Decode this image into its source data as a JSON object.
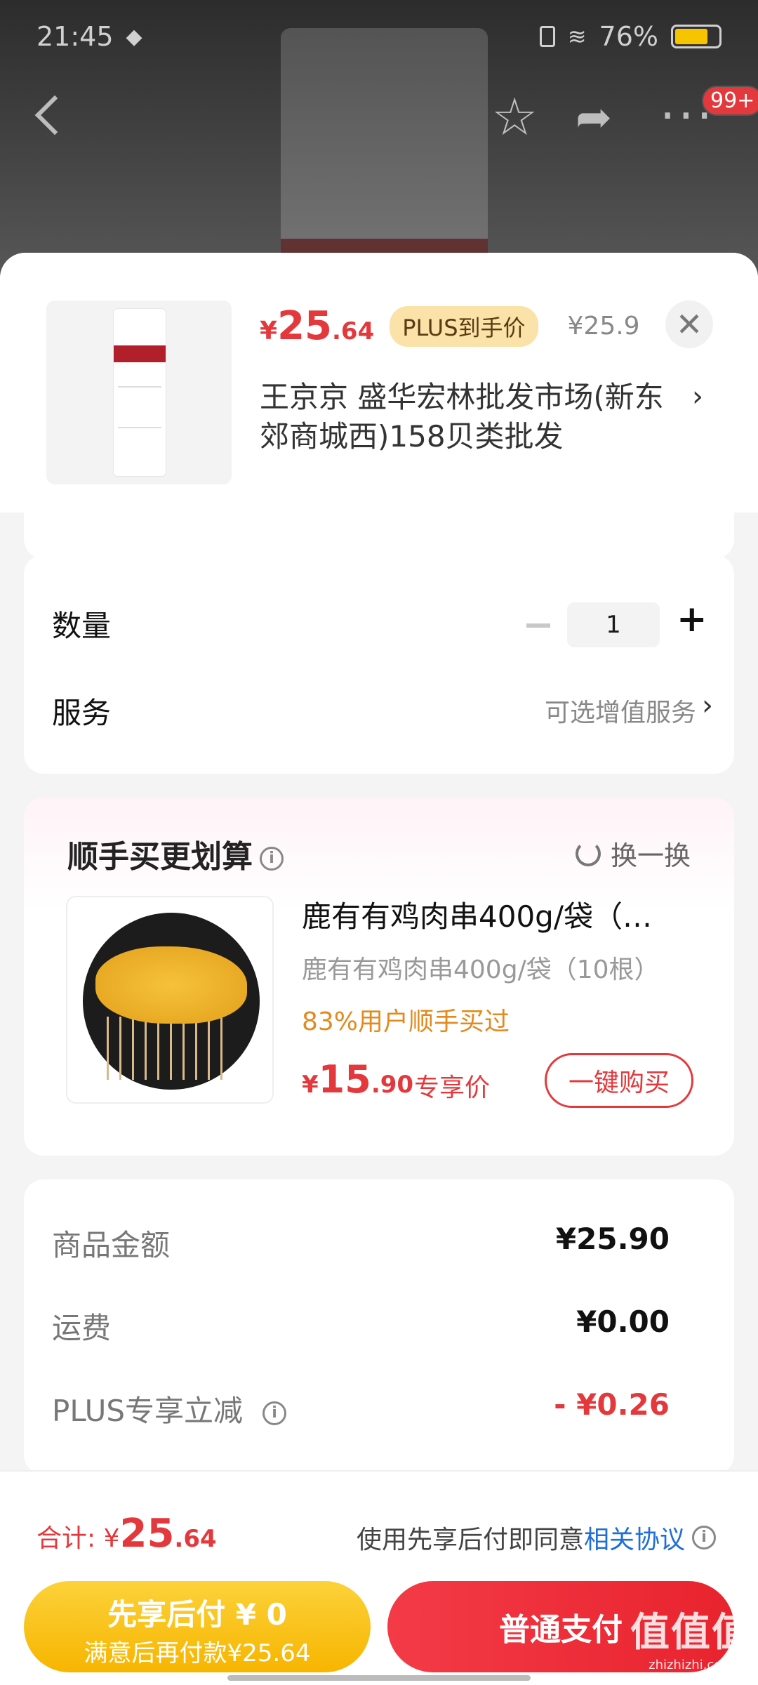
{
  "status_bar": {
    "time": "21:45",
    "battery": "76%"
  },
  "top_nav": {
    "badge": "99+"
  },
  "product": {
    "price_currency": "¥",
    "price_int": "25",
    "price_dec": ".64",
    "plus_tag": "PLUS到手价",
    "original_price": "¥25.9",
    "shop_name": "王京京  盛华宏林批发市场(新东郊商城西)158贝类批发"
  },
  "quantity": {
    "label": "数量",
    "value": "1"
  },
  "service": {
    "label": "服务",
    "value": "可选增值服务"
  },
  "recommend": {
    "title": "顺手买更划算",
    "refresh_label": "换一换",
    "item_name": "鹿有有鸡肉串400g/袋（…",
    "item_sub": "鹿有有鸡肉串400g/袋（10根）",
    "bought_text": "83%用户顺手买过",
    "price_currency": "¥",
    "price_int": "15",
    "price_dec": ".90",
    "price_tag": "专享价",
    "buy_label": "一键购买"
  },
  "summary": {
    "rows": [
      {
        "label": "商品金额",
        "value": "¥25.90"
      },
      {
        "label": "运费",
        "value": "¥0.00"
      },
      {
        "label": "PLUS专享立减",
        "value": "- ¥0.26"
      }
    ]
  },
  "footer": {
    "total_label": "合计: ¥",
    "total_int": "25",
    "total_dec": ".64",
    "agree_prefix": "使用先享后付即同意",
    "agree_link": "相关协议",
    "later_line1": "先享后付 ¥ 0",
    "later_line2": "满意后再付款¥25.64",
    "pay_label": "普通支付"
  },
  "watermark": {
    "brand": "值值值",
    "site": "zhizhizhi.com"
  },
  "colors": {
    "accent": "#e4393c",
    "plus": "#fbe2a8",
    "later_btn": "#f7b500",
    "link": "#1f6fd6"
  }
}
